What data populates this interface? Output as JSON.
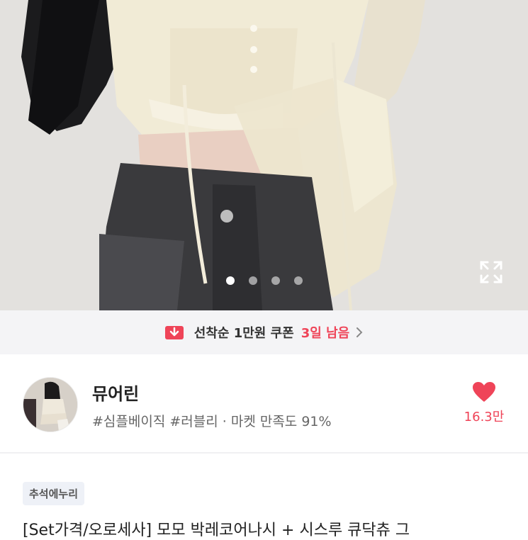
{
  "carousel": {
    "total_slides": 4,
    "active_index": 0,
    "expand_icon": "expand-icon"
  },
  "coupon": {
    "icon": "coupon-icon",
    "label": "선착순 1만원 쿠폰",
    "remaining": "3일 남음",
    "chevron": "chevron-right-icon"
  },
  "shop": {
    "name": "뮤어린",
    "tags": "#심플베이직 #러블리 · 마켓 만족도 91%",
    "like_count": "16.3만",
    "heart_color": "#ef4458"
  },
  "product": {
    "badge": "추석에누리",
    "title": "[Set가격/오로세사] 모모 박레코어나시 + 시스루 큐닥츄 그"
  },
  "colors": {
    "accent": "#ef4458",
    "coupon_bg": "#f4f4f6"
  }
}
